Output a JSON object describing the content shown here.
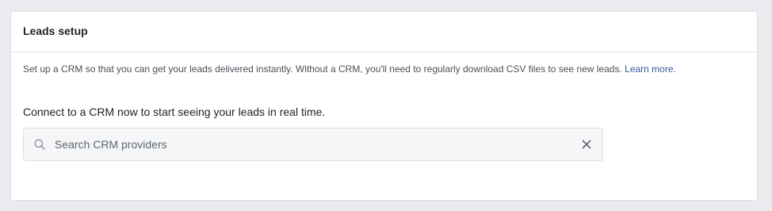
{
  "leads_setup": {
    "title": "Leads setup",
    "description": "Set up a CRM so that you can get your leads delivered instantly. Without a CRM, you'll need to regularly download CSV files to see new leads.",
    "learn_more_label": "Learn more.",
    "connect_text": "Connect to a CRM now to start seeing your leads in real time.",
    "search": {
      "placeholder": "Search CRM providers",
      "value": "",
      "icon": "search-icon",
      "clear_icon": "close-icon"
    }
  },
  "colors": {
    "page_background": "#e9ebee",
    "link": "#365899",
    "text_primary": "#1d2129",
    "text_secondary": "#4b4f56"
  }
}
